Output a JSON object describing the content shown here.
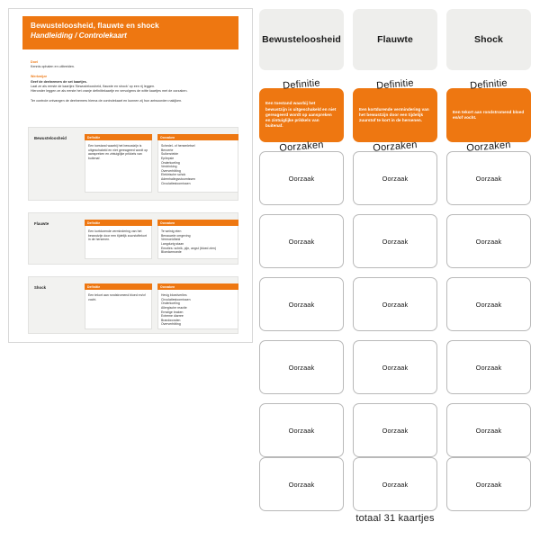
{
  "document": {
    "header": {
      "title": "Bewusteloosheid, flauwte en shock",
      "subtitle": "Handleiding / Controlekaart"
    },
    "sections": [
      {
        "heading": "Doel",
        "lines": [
          "Kennis ophalen en uitbreiden."
        ]
      },
      {
        "heading": "Werkwijze",
        "lines": [
          "Geef de deelnemers de set kaartjes.",
          "Laat ze als eerste de kaartjes 'Bewusteloosheid, flauwte en shock' op een rij leggen.",
          "Hieronder leggen ze als eerste het oranje definitiekaartje en vervolgens de witte kaartjes met de oorzaken.",
          "",
          "Ter controle ontvangen de deelnemers hierna de controlekaart en kunnen zij hun antwoorden nakijken."
        ]
      }
    ],
    "conditions": [
      {
        "name": "Bewusteloosheid",
        "definition_header": "Definitie",
        "causes_header": "Oorzaken",
        "definition": "Een toestand waarbij het bewustzijn is uitgeschakeld en niet gereageerd wordt op aanspreken en zintuiglijke prikkels van buitenaf.",
        "causes": [
          "Schedel- of hersenletsel",
          "Beroerte",
          "Suikerziekte",
          "Epilepsie",
          "Onderkoeling",
          "Verdrinking",
          "Oververhitting",
          "Elektrische schok",
          "Ademhalingsstoornissen",
          "Circulatiestoornissen"
        ]
      },
      {
        "name": "Flauwte",
        "definition_header": "Definitie",
        "causes_header": "Oorzaken",
        "definition": "Een kortdurende vermindering van het bewustzijn door een tijdelijk zuurstoftekort in de hersenen.",
        "causes": [
          "Te weinig eten",
          "Benauwde omgeving",
          "Vermoeidheid",
          "Langdurig staan",
          "Emoties: schrik, pijn, angst (bloed zien)",
          "Bloedarmoede"
        ]
      },
      {
        "name": "Shock",
        "definition_header": "Definitie",
        "causes_header": "Oorzaken",
        "definition": "Een tekort aan rondstromend bloed en/of vocht.",
        "causes": [
          "Hevig bloedverlies",
          "Circulatiestoornissen",
          "Onderkoeling",
          "Allergische reactie",
          "Ernstige braken",
          "Extreme diarree",
          "Brandwonden",
          "Oververhitting"
        ]
      }
    ]
  },
  "board": {
    "columns": [
      {
        "title": "Bewusteloosheid",
        "definition_label": "Definitie",
        "definition_text": "Een toestand waarbij het bewustzijn is uitgeschakeld en niet gereageerd wordt op aanspreken en zintuiglijke prikkels van buitenaf.",
        "causes_label": "Oorzaken",
        "cause_card_label": "Oorzaak",
        "cause_card_count": 6
      },
      {
        "title": "Flauwte",
        "definition_label": "Definitie",
        "definition_text": "Een kortdurende vermindering van het bewustzijn door een tijdelijk zuurstof te kort in de hersenen.",
        "causes_label": "Oorzaken",
        "cause_card_label": "Oorzaak",
        "cause_card_count": 6
      },
      {
        "title": "Shock",
        "definition_label": "Definitie",
        "definition_text": "Een tekort aan rondstromend bloed en/of vocht.",
        "causes_label": "Oorzaken",
        "cause_card_label": "Oorzaak",
        "cause_card_count": 6
      }
    ],
    "footer": "totaal 31 kaartjes"
  },
  "colors": {
    "accent_orange": "#ee7711",
    "card_grey": "#eeeeec",
    "card_border": "#b9b9b9",
    "panel_grey": "#f2f2f0"
  }
}
